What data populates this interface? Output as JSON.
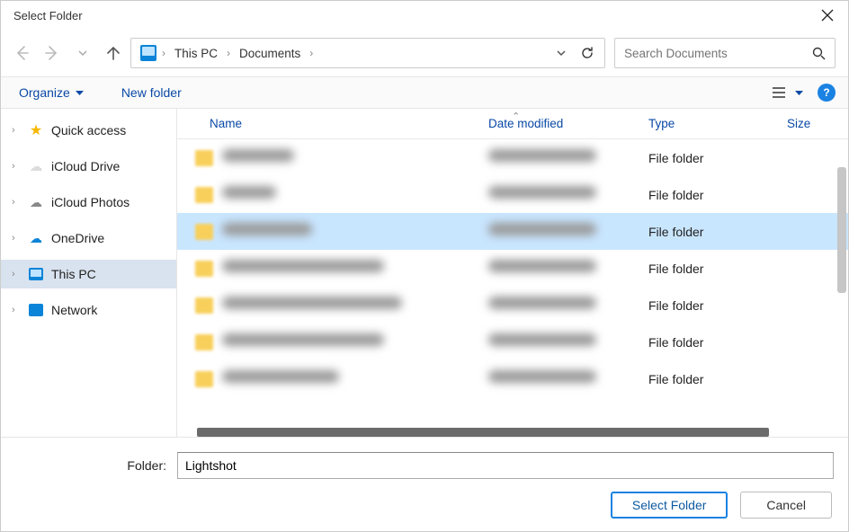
{
  "window": {
    "title": "Select Folder"
  },
  "nav": {
    "breadcrumbs": [
      "This PC",
      "Documents"
    ],
    "search_placeholder": "Search Documents"
  },
  "toolbar": {
    "organize_label": "Organize",
    "newfolder_label": "New folder"
  },
  "sidebar": {
    "items": [
      {
        "label": "Quick access",
        "icon": "star"
      },
      {
        "label": "iCloud Drive",
        "icon": "cloud-white"
      },
      {
        "label": "iCloud Photos",
        "icon": "cloud-color"
      },
      {
        "label": "OneDrive",
        "icon": "cloud-blue"
      },
      {
        "label": "This PC",
        "icon": "pc",
        "active": true
      },
      {
        "label": "Network",
        "icon": "net"
      }
    ]
  },
  "columns": {
    "name": "Name",
    "date": "Date modified",
    "type": "Type",
    "size": "Size"
  },
  "rows": [
    {
      "type": "File folder",
      "selected": false
    },
    {
      "type": "File folder",
      "selected": false
    },
    {
      "type": "File folder",
      "selected": true
    },
    {
      "type": "File folder",
      "selected": false
    },
    {
      "type": "File folder",
      "selected": false
    },
    {
      "type": "File folder",
      "selected": false
    },
    {
      "type": "File folder",
      "selected": false
    }
  ],
  "footer": {
    "folder_label": "Folder:",
    "folder_value": "Lightshot",
    "select_label": "Select Folder",
    "cancel_label": "Cancel"
  }
}
